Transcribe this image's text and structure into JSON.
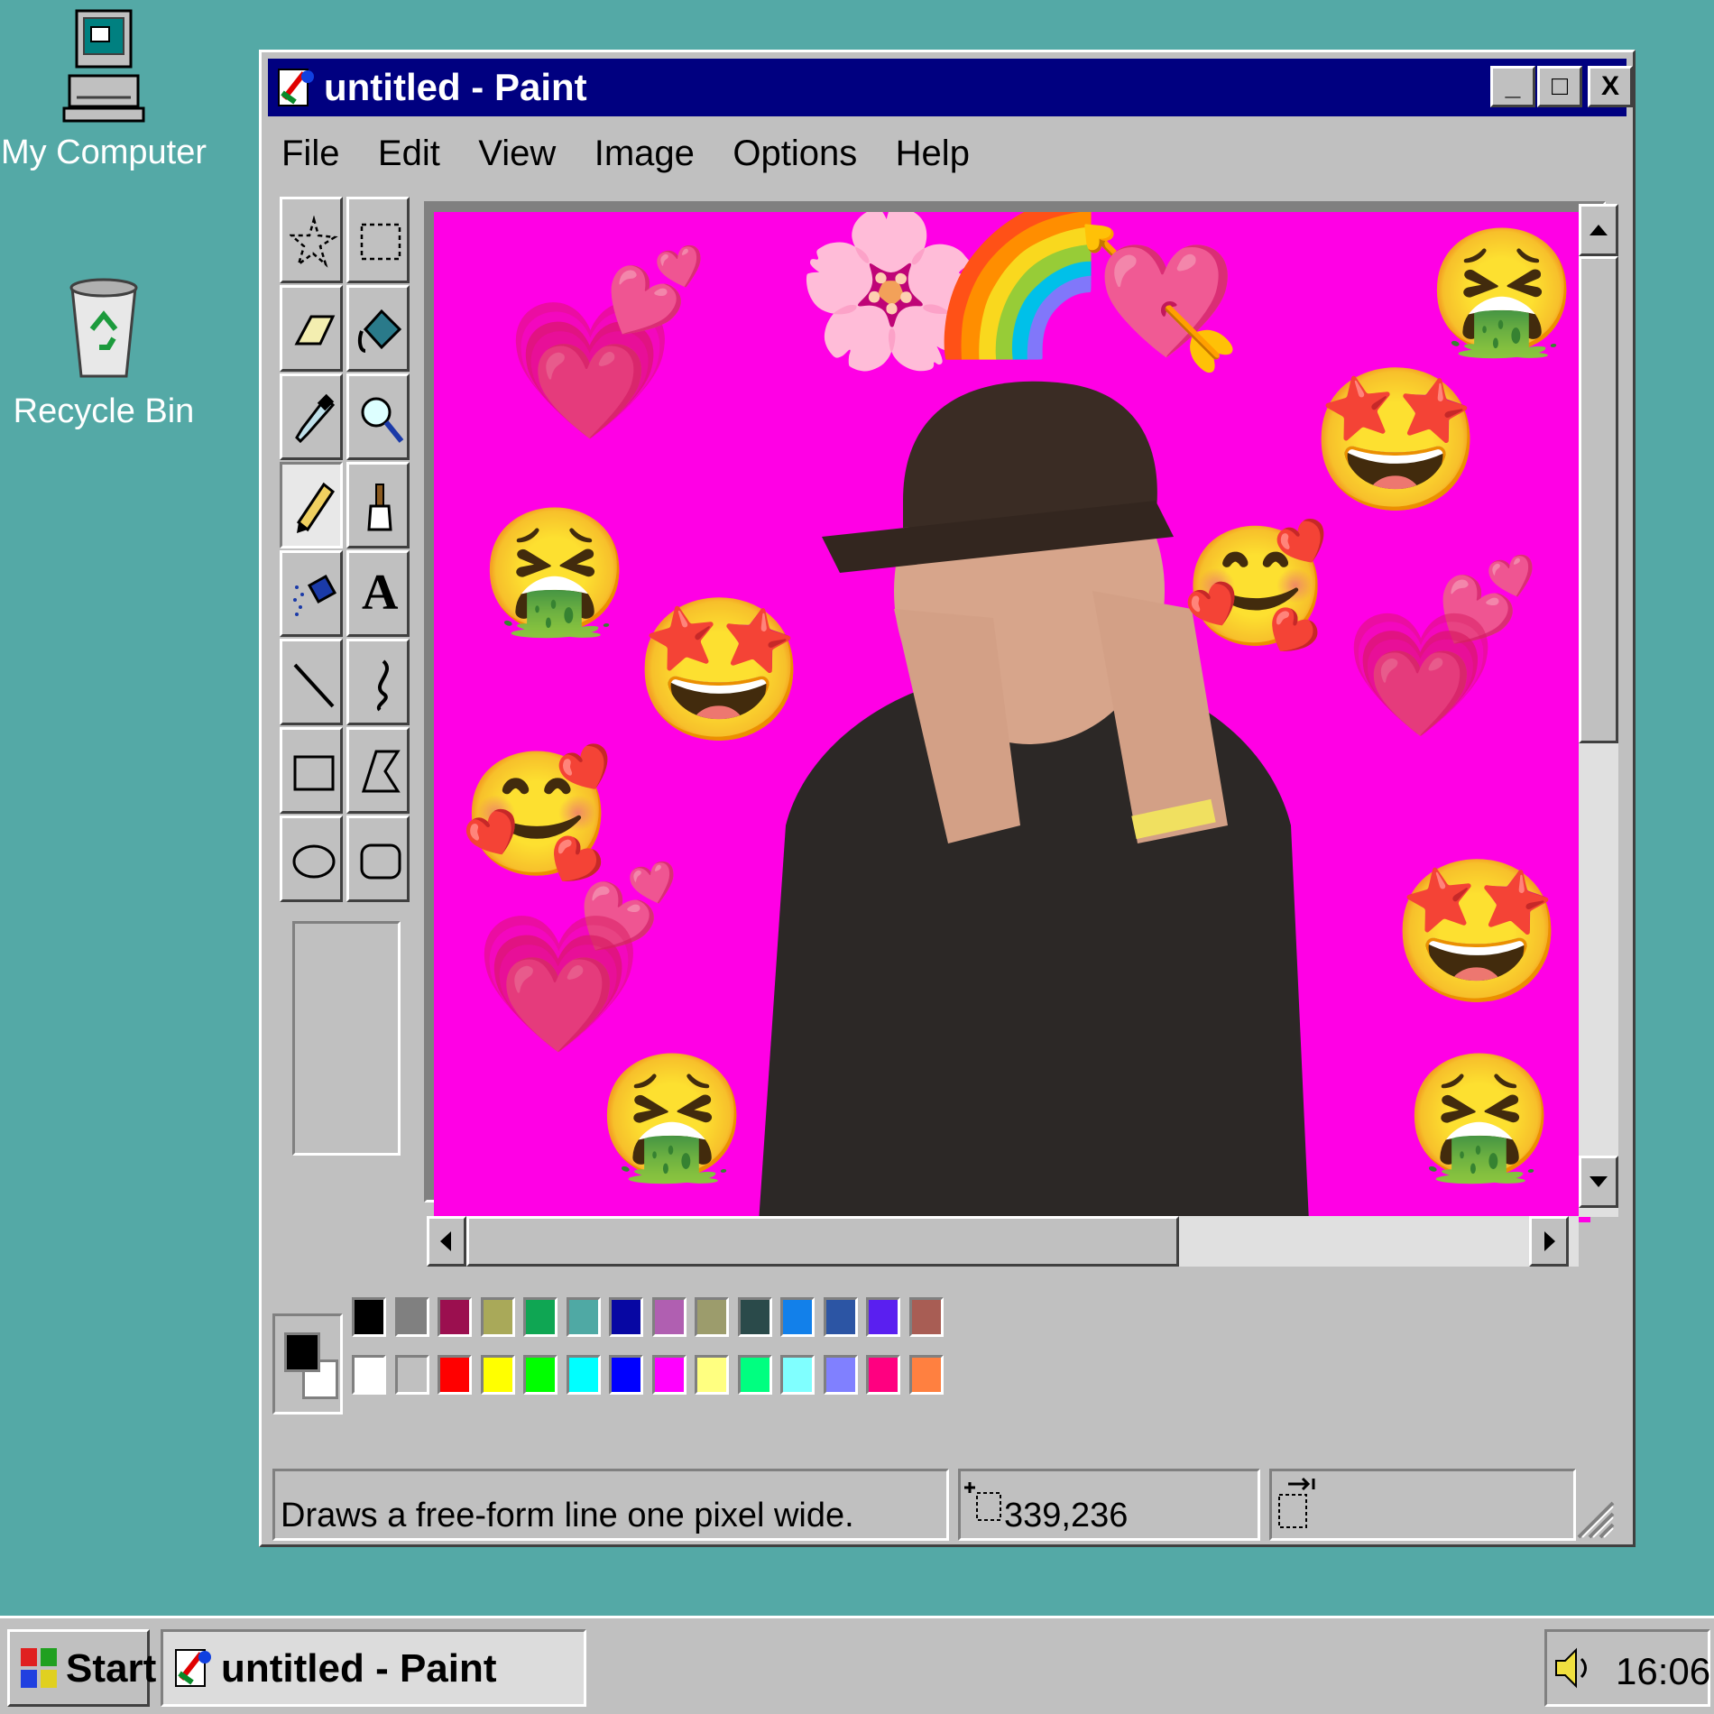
{
  "desktop": {
    "icons": [
      {
        "label": "My Computer"
      },
      {
        "label": "Recycle Bin"
      }
    ]
  },
  "window": {
    "title": "untitled - Paint",
    "buttons": {
      "minimize": "_",
      "maximize": "□",
      "close": "X"
    },
    "menu": [
      "File",
      "Edit",
      "View",
      "Image",
      "Options",
      "Help"
    ]
  },
  "toolbox": {
    "tools": [
      {
        "name": "free-form-select-icon"
      },
      {
        "name": "rect-select-icon"
      },
      {
        "name": "eraser-icon"
      },
      {
        "name": "fill-bucket-icon"
      },
      {
        "name": "color-picker-icon"
      },
      {
        "name": "magnifier-icon"
      },
      {
        "name": "pencil-icon",
        "selected": true
      },
      {
        "name": "brush-icon"
      },
      {
        "name": "airbrush-icon"
      },
      {
        "name": "text-icon",
        "glyph": "A"
      },
      {
        "name": "line-icon"
      },
      {
        "name": "curve-icon"
      },
      {
        "name": "rectangle-icon"
      },
      {
        "name": "polygon-icon"
      },
      {
        "name": "ellipse-icon"
      },
      {
        "name": "rounded-rectangle-icon"
      }
    ]
  },
  "canvas": {
    "background": "#ff00e5",
    "emojis": [
      "💗",
      "💕",
      "🌸",
      "🌈",
      "💘",
      "🤮",
      "🤩",
      "🤮",
      "🥰",
      "💕",
      "💗",
      "🤩",
      "🥰",
      "🤩",
      "💕",
      "💗",
      "🤮",
      "🤮"
    ]
  },
  "palette": {
    "foreground": "#000000",
    "background": "#ffffff",
    "top_row": [
      "#000000",
      "#808080",
      "#9b0f4f",
      "#a9a959",
      "#0fa653",
      "#4fa9a4",
      "#0707a3",
      "#b05fb1",
      "#9c9c6c",
      "#2a4a4a",
      "#1280ea",
      "#2c55a4",
      "#5a1ff0",
      "#a85d54"
    ],
    "bottom_row": [
      "#ffffff",
      "#c0c0c0",
      "#ff0000",
      "#ffff00",
      "#00ff00",
      "#00ffff",
      "#0000ff",
      "#ff00ff",
      "#ffff80",
      "#00ff80",
      "#80ffff",
      "#8080ff",
      "#ff0080",
      "#ff8040"
    ]
  },
  "statusbar": {
    "help_text": "Draws a free-form line one pixel wide.",
    "coordinates": "339,236",
    "size": ""
  },
  "taskbar": {
    "start_label": "Start",
    "task_label": "untitled - Paint",
    "clock": "16:06"
  }
}
